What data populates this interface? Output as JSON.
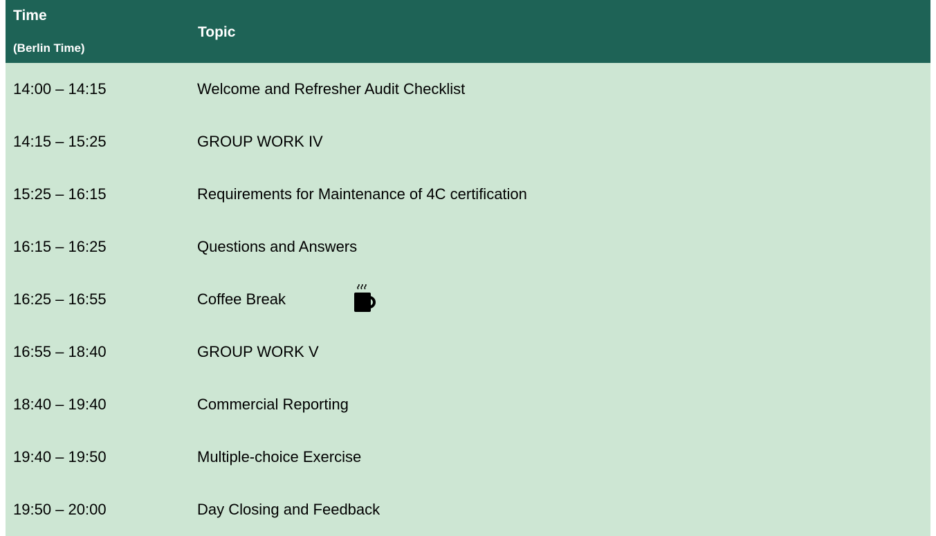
{
  "header": {
    "time_label": "Time",
    "time_sublabel": "(Berlin Time)",
    "topic_label": "Topic"
  },
  "colors": {
    "header_bg": "#1e6356",
    "header_text": "#ffffff",
    "row_bg": "#cde6d3",
    "row_text": "#000000"
  },
  "rows": [
    {
      "time": "14:00 – 14:15",
      "topic": "Welcome and Refresher Audit Checklist"
    },
    {
      "time": "14:15 – 15:25",
      "topic": "GROUP WORK IV"
    },
    {
      "time": "15:25 – 16:15",
      "topic": "Requirements for Maintenance of 4C certification"
    },
    {
      "time": "16:15 – 16:25",
      "topic": "Questions and Answers"
    },
    {
      "time": "16:25 – 16:55",
      "topic": "Coffee Break",
      "icon": "coffee-cup-icon"
    },
    {
      "time": "16:55 – 18:40",
      "topic": "GROUP WORK V"
    },
    {
      "time": "18:40 – 19:40",
      "topic": "Commercial Reporting"
    },
    {
      "time": "19:40 – 19:50",
      "topic": "Multiple-choice Exercise"
    },
    {
      "time": "19:50 – 20:00",
      "topic": "Day Closing and Feedback"
    }
  ]
}
